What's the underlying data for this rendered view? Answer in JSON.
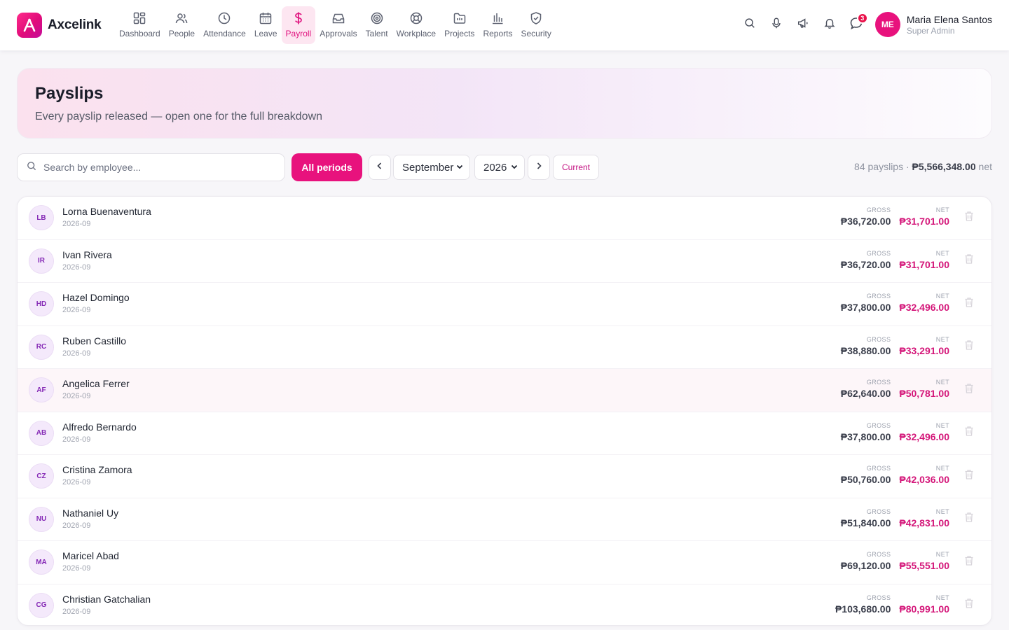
{
  "app": {
    "name": "Axcelink"
  },
  "nav": {
    "items": [
      {
        "label": "Dashboard",
        "icon": "dashboard-icon"
      },
      {
        "label": "People",
        "icon": "people-icon"
      },
      {
        "label": "Attendance",
        "icon": "clock-icon"
      },
      {
        "label": "Leave",
        "icon": "calendar-icon"
      },
      {
        "label": "Payroll",
        "icon": "dollar-icon",
        "active": true
      },
      {
        "label": "Approvals",
        "icon": "inbox-icon"
      },
      {
        "label": "Talent",
        "icon": "target-icon"
      },
      {
        "label": "Workplace",
        "icon": "lifebuoy-icon"
      },
      {
        "label": "Projects",
        "icon": "folder-icon"
      },
      {
        "label": "Reports",
        "icon": "bar-chart-icon"
      },
      {
        "label": "Security",
        "icon": "shield-icon"
      }
    ]
  },
  "tools": {
    "messages_badge": "3"
  },
  "user": {
    "initials": "ME",
    "name": "Maria Elena Santos",
    "role": "Super Admin"
  },
  "hero": {
    "title": "Payslips",
    "subtitle": "Every payslip released — open one for the full breakdown"
  },
  "filters": {
    "search_placeholder": "Search by employee...",
    "all_periods_label": "All periods",
    "month": "September",
    "year": "2026",
    "current_label": "Current"
  },
  "summary": {
    "count": "84 payslips",
    "separator": "·",
    "total": "₱5,566,348.00",
    "suffix": "net"
  },
  "labels": {
    "gross": "GROSS",
    "net": "NET"
  },
  "colors": {
    "accent": "#e8127d",
    "net_amount": "#d41679",
    "avatar_bg": "#f4e9fb"
  },
  "payslips": [
    {
      "initials": "LB",
      "name": "Lorna Buenaventura",
      "period": "2026-09",
      "gross": "₱36,720.00",
      "net": "₱31,701.00"
    },
    {
      "initials": "IR",
      "name": "Ivan Rivera",
      "period": "2026-09",
      "gross": "₱36,720.00",
      "net": "₱31,701.00"
    },
    {
      "initials": "HD",
      "name": "Hazel Domingo",
      "period": "2026-09",
      "gross": "₱37,800.00",
      "net": "₱32,496.00"
    },
    {
      "initials": "RC",
      "name": "Ruben Castillo",
      "period": "2026-09",
      "gross": "₱38,880.00",
      "net": "₱33,291.00"
    },
    {
      "initials": "AF",
      "name": "Angelica Ferrer",
      "period": "2026-09",
      "gross": "₱62,640.00",
      "net": "₱50,781.00",
      "hovered": true
    },
    {
      "initials": "AB",
      "name": "Alfredo Bernardo",
      "period": "2026-09",
      "gross": "₱37,800.00",
      "net": "₱32,496.00"
    },
    {
      "initials": "CZ",
      "name": "Cristina Zamora",
      "period": "2026-09",
      "gross": "₱50,760.00",
      "net": "₱42,036.00"
    },
    {
      "initials": "NU",
      "name": "Nathaniel Uy",
      "period": "2026-09",
      "gross": "₱51,840.00",
      "net": "₱42,831.00"
    },
    {
      "initials": "MA",
      "name": "Maricel Abad",
      "period": "2026-09",
      "gross": "₱69,120.00",
      "net": "₱55,551.00"
    },
    {
      "initials": "CG",
      "name": "Christian Gatchalian",
      "period": "2026-09",
      "gross": "₱103,680.00",
      "net": "₱80,991.00"
    }
  ]
}
